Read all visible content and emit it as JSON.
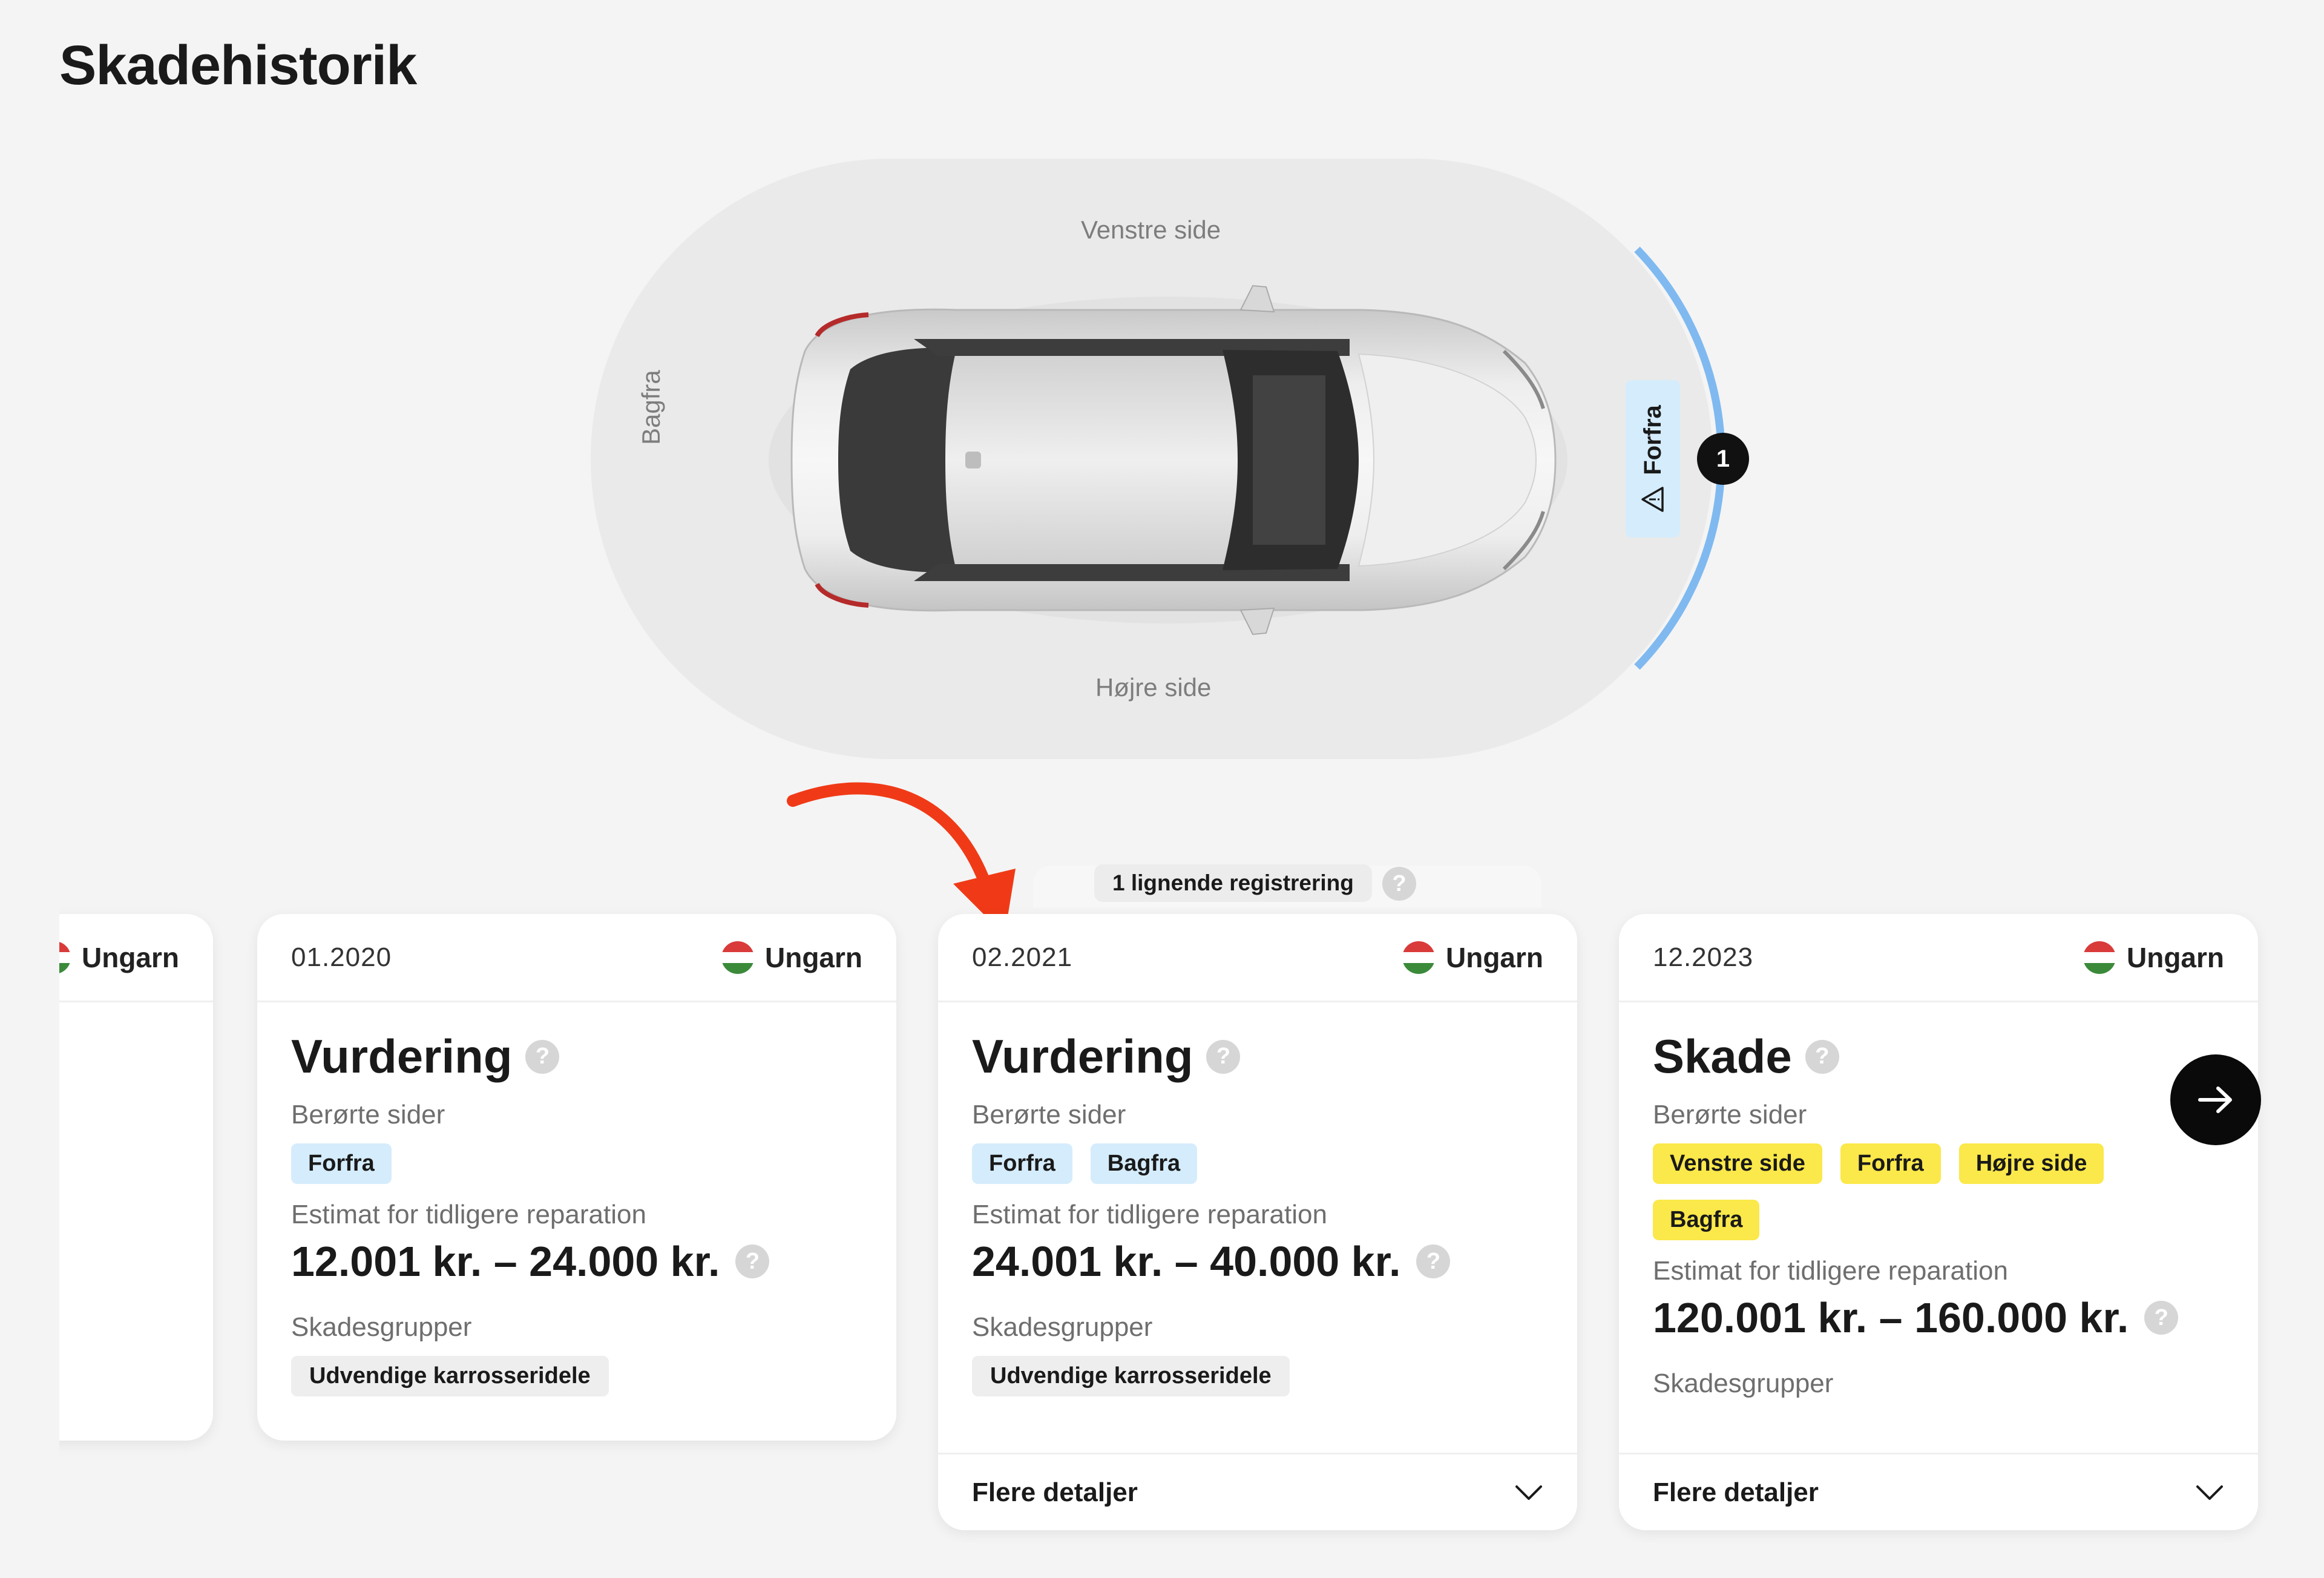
{
  "page": {
    "title": "Skadehistorik"
  },
  "diagram": {
    "labels": {
      "left": "Venstre side",
      "right": "Højre side",
      "rear": "Bagfra",
      "front": "Forfra"
    },
    "front_count": "1",
    "highlight_color": "#7fb9f0"
  },
  "similar": {
    "label": "1 lignende registrering",
    "help": "?"
  },
  "cards": [
    {
      "date": "",
      "country": "Ungarn"
    },
    {
      "date": "01.2020",
      "country": "Ungarn",
      "title": "Vurdering",
      "help": "?",
      "affected_label": "Berørte sider",
      "affected": [
        "Forfra"
      ],
      "estimate_label": "Estimat for tidligere reparation",
      "estimate": "12.001 kr. – 24.000 kr.",
      "groups_label": "Skadesgrupper",
      "groups": [
        "Udvendige karrosseridele"
      ]
    },
    {
      "date": "02.2021",
      "country": "Ungarn",
      "title": "Vurdering",
      "help": "?",
      "affected_label": "Berørte sider",
      "affected": [
        "Forfra",
        "Bagfra"
      ],
      "estimate_label": "Estimat for tidligere reparation",
      "estimate": "24.001 kr. – 40.000 kr.",
      "groups_label": "Skadesgrupper",
      "groups": [
        "Udvendige karrosseridele"
      ],
      "details": "Flere detaljer"
    },
    {
      "date": "12.2023",
      "country": "Ungarn",
      "title": "Skade",
      "help": "?",
      "affected_label": "Berørte sider",
      "affected": [
        "Venstre side",
        "Forfra",
        "Højre side",
        "Bagfra"
      ],
      "estimate_label": "Estimat for tidligere reparation",
      "estimate": "120.001 kr. – 160.000 kr.",
      "groups_label": "Skadesgrupper",
      "details": "Flere detaljer"
    }
  ],
  "colors": {
    "tag_blue": "#d5ecfc",
    "tag_yellow": "#fbe84a",
    "arrow_red": "#f03a17"
  },
  "icons": [
    "warning-icon",
    "question-icon",
    "chevron-down-icon",
    "arrow-right-icon",
    "hungary-flag-icon"
  ]
}
